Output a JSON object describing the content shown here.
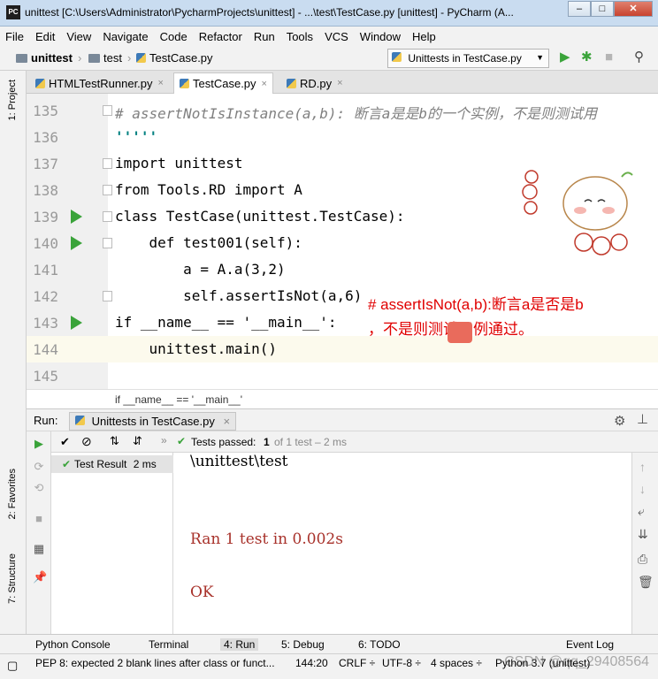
{
  "window": {
    "app_icon_text": "PC",
    "title": "unittest [C:\\Users\\Administrator\\PycharmProjects\\unittest] - ...\\test\\TestCase.py [unittest] - PyCharm (A...",
    "min": "–",
    "max": "□",
    "close": "✕"
  },
  "menu": [
    "File",
    "Edit",
    "View",
    "Navigate",
    "Code",
    "Refactor",
    "Run",
    "Tools",
    "VCS",
    "Window",
    "Help"
  ],
  "breadcrumb": {
    "project": "unittest",
    "folder": "test",
    "file": "TestCase.py"
  },
  "run_config": "Unittests in TestCase.py",
  "left_sidebar": {
    "project": "1: Project",
    "favorites": "2: Favorites",
    "structure": "7: Structure"
  },
  "tabs": [
    {
      "label": "HTMLTestRunner.py",
      "close": "×"
    },
    {
      "label": "TestCase.py",
      "close": "×"
    },
    {
      "label": "RD.py",
      "close": "×"
    }
  ],
  "editor": {
    "lines": [
      {
        "num": "135",
        "code": "# assertNotIsInstance(a,b): 断言a是是b的一个实例，不是则测试用"
      },
      {
        "num": "136",
        "code": "'''''"
      },
      {
        "num": "137",
        "code": "import unittest"
      },
      {
        "num": "138",
        "code": "from Tools.RD import A"
      },
      {
        "num": "139",
        "code": "class TestCase(unittest.TestCase):"
      },
      {
        "num": "140",
        "code": "    def test001(self):"
      },
      {
        "num": "141",
        "code": "        a = A.a(3,2)"
      },
      {
        "num": "142",
        "code": "        self.assertIsNot(a,6)"
      },
      {
        "num": "143",
        "code": "if __name__ == '__main__':"
      },
      {
        "num": "144",
        "code": "    unittest.main()"
      },
      {
        "num": "145",
        "code": ""
      }
    ],
    "annotation_line1": "# assertIsNot(a,b):断言a是否是b",
    "annotation_line2": "，不是则测试用例通过。",
    "bottom_crumb": "if __name__ == '__main__'"
  },
  "run_panel": {
    "label": "Run:",
    "tab": "Unittests in TestCase.py",
    "tests_passed": "Tests passed:",
    "passed_count": "1",
    "passed_detail": "of 1 test – 2 ms",
    "tree_item": "Test Result",
    "tree_time": "2 ms",
    "console": [
      "\\unittest\\test",
      "Ran 1 test in 0.002s",
      "OK"
    ]
  },
  "bottom_tabs": {
    "python_console": "Python Console",
    "terminal": "Terminal",
    "run": "4: Run",
    "debug": "5: Debug",
    "todo": "6: TODO",
    "event_log": "Event Log"
  },
  "status": {
    "message": "PEP 8: expected 2 blank lines after class or funct...",
    "position": "144:20",
    "line_sep": "CRLF ÷",
    "encoding": "UTF-8 ÷",
    "indent": "4 spaces ÷",
    "interpreter": "Python 3.7 (unittest)",
    "watermark": "CSDN @qq_29408564"
  },
  "colors": {
    "run_green": "#3aa33a",
    "annotation_red": "#e00000",
    "keyword": "#000080"
  }
}
